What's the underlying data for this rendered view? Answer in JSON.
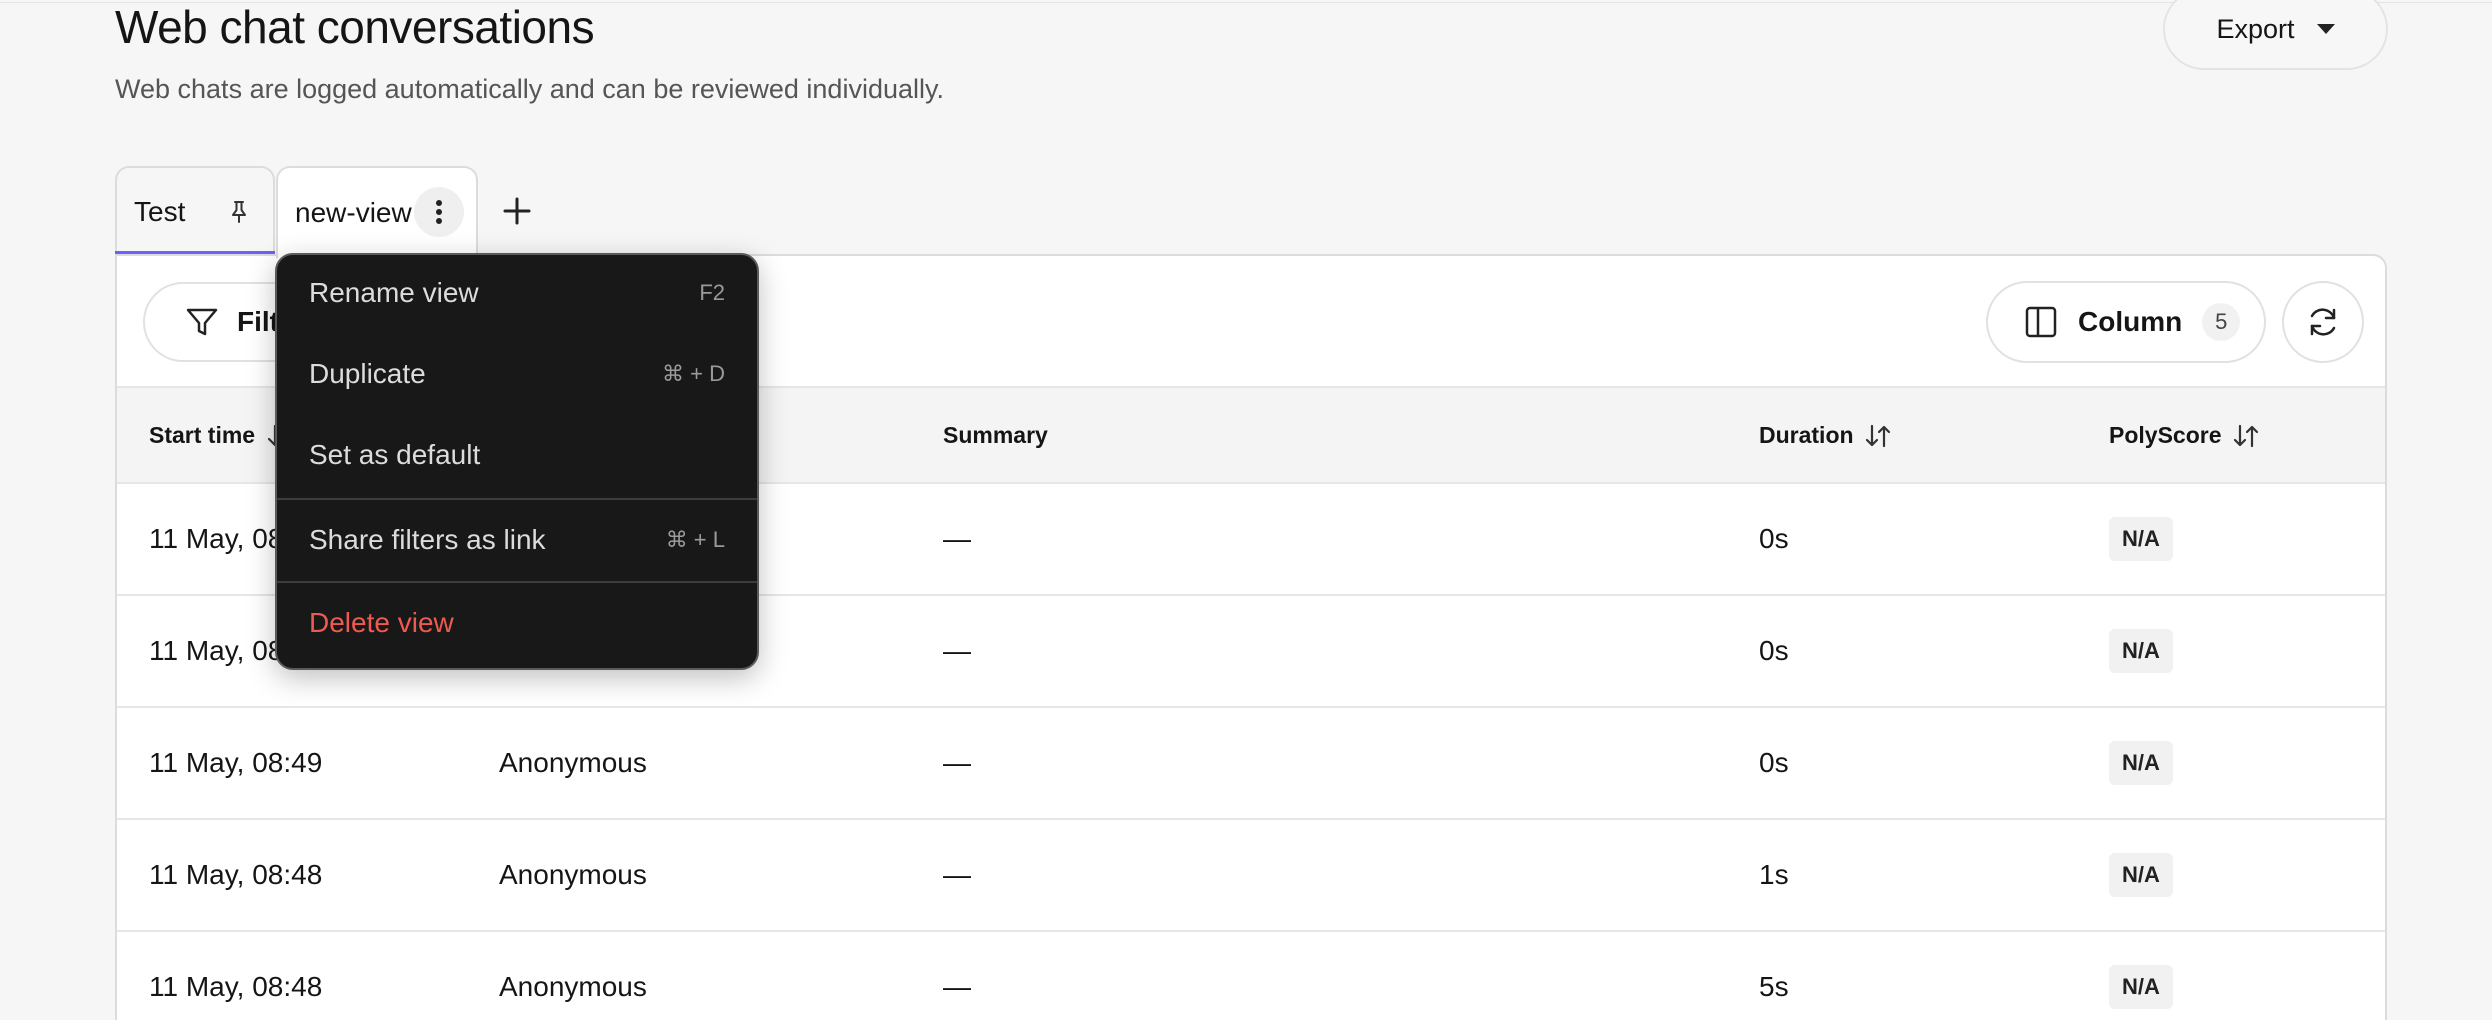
{
  "header": {
    "title": "Web chat conversations",
    "subtitle": "Web chats are logged automatically and can be reviewed individually.",
    "export_label": "Export"
  },
  "tabs": [
    {
      "label": "Test",
      "pinned": true,
      "active": true
    },
    {
      "label": "new-view",
      "pinned": false,
      "active": false
    }
  ],
  "toolbar": {
    "filter_label": "Filt",
    "column_label": "Column",
    "column_count": "5"
  },
  "table": {
    "columns": [
      "Start time",
      "Summary",
      "Duration",
      "PolyScore"
    ],
    "rows": [
      {
        "start_time": "11 May, 08:",
        "user": "",
        "summary": "—",
        "duration": "0s",
        "polyscore": "N/A"
      },
      {
        "start_time": "11 May, 08:",
        "user": "",
        "summary": "—",
        "duration": "0s",
        "polyscore": "N/A"
      },
      {
        "start_time": "11 May, 08:49",
        "user": "Anonymous",
        "summary": "—",
        "duration": "0s",
        "polyscore": "N/A"
      },
      {
        "start_time": "11 May, 08:48",
        "user": "Anonymous",
        "summary": "—",
        "duration": "1s",
        "polyscore": "N/A"
      },
      {
        "start_time": "11 May, 08:48",
        "user": "Anonymous",
        "summary": "—",
        "duration": "5s",
        "polyscore": "N/A"
      }
    ]
  },
  "context_menu": {
    "items": [
      {
        "label": "Rename view",
        "shortcut": "F2"
      },
      {
        "label": "Duplicate",
        "shortcut": "⌘ + D"
      },
      {
        "label": "Set as default",
        "shortcut": ""
      },
      {
        "label": "Share filters as link",
        "shortcut": "⌘ + L"
      },
      {
        "label": "Delete view",
        "shortcut": ""
      }
    ]
  },
  "colors": {
    "accent": "#6a63f6",
    "danger": "#ee5a4f",
    "menu_bg": "#181818"
  }
}
